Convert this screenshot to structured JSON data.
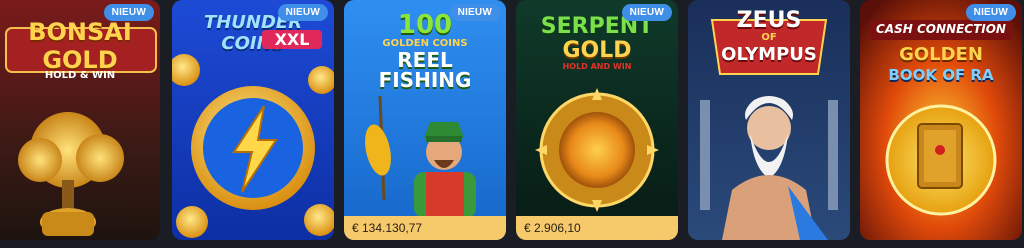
{
  "games": [
    {
      "title": "BONSAI GOLD",
      "subtitle": "HOLD & WIN",
      "badge": "NIEUW",
      "icon": "gold-bonsai-tree-icon"
    },
    {
      "title": "THUNDER COINS",
      "subtitle": "XXL",
      "badge": "NIEUW",
      "icon": "lightning-coin-icon"
    },
    {
      "title_line1": "100",
      "title_line2": "GOLDEN COINS",
      "title_line3": "REEL",
      "title_line4": "FISHING",
      "badge": "NIEUW",
      "jackpot": "€ 134.130,77",
      "icon": "fisherman-icon"
    },
    {
      "title_line1": "SERPENT",
      "title_line2": "GOLD",
      "subtitle": "HOLD AND WIN",
      "badge": "NIEUW",
      "jackpot": "€ 2.906,10",
      "icon": "serpent-coin-icon"
    },
    {
      "title_line1": "ZEUS",
      "title_line2": "OF",
      "title_line3": "OLYMPUS",
      "icon": "zeus-icon"
    },
    {
      "title_line1": "CASH CONNECTION",
      "title_line2": "GOLDEN",
      "title_line3": "BOOK OF RA",
      "badge": "NIEUW",
      "icon": "golden-book-coin-icon"
    }
  ]
}
